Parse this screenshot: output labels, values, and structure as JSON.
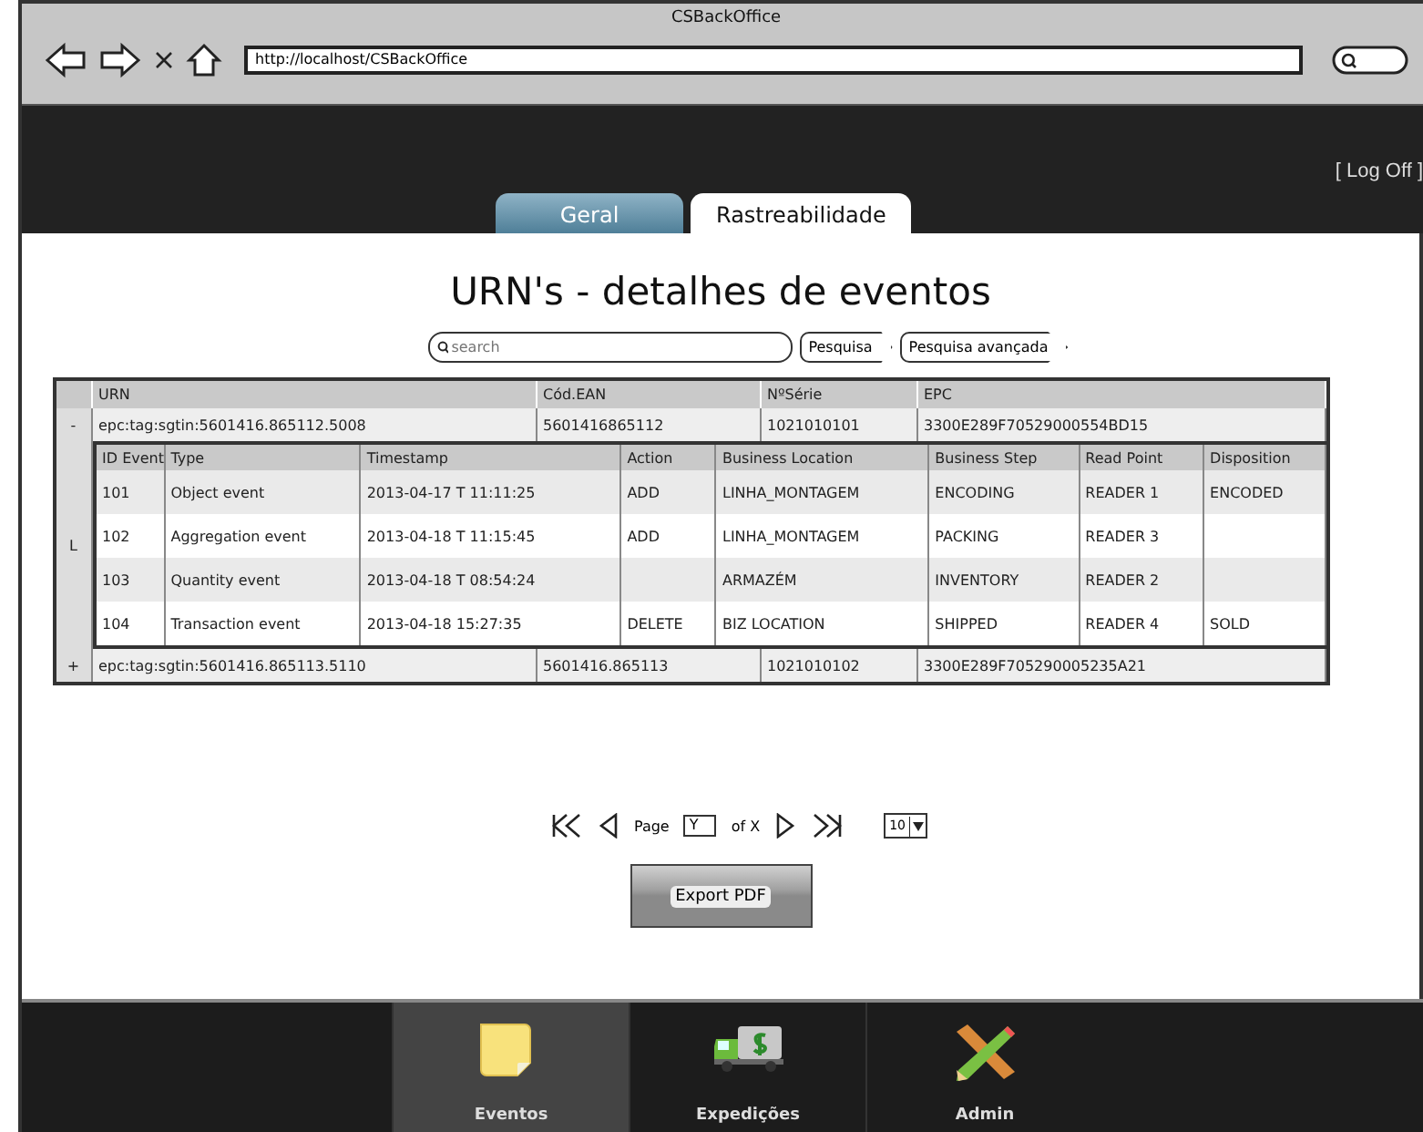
{
  "window": {
    "title": "CSBackOffice"
  },
  "address_bar": {
    "url": "http://localhost/CSBackOffice"
  },
  "header": {
    "logoff": "[ Log Off ]"
  },
  "tabs": [
    {
      "label": "Geral",
      "selected": false
    },
    {
      "label": "Rastreabilidade",
      "selected": true
    }
  ],
  "page_title": "URN's - detalhes de eventos",
  "search": {
    "placeholder": "search"
  },
  "search_buttons": [
    "Pesquisa",
    "Pesquisa avançada"
  ],
  "urn_table": {
    "columns": [
      "URN",
      "Cód.EAN",
      "NºSérie",
      "EPC"
    ],
    "rows": [
      {
        "toggle": "-",
        "cells": [
          "epc:tag:sgtin:5601416.865112.5008",
          "5601416865112",
          "1021010101",
          "3300E289F70529000554BD15"
        ],
        "child_marker": "L",
        "events": {
          "columns": [
            "ID Event",
            "Type",
            "Timestamp",
            "Action",
            "Business Location",
            "Business Step",
            "Read Point",
            "Disposition"
          ],
          "rows": [
            [
              "101",
              "Object event",
              "2013-04-17 T 11:11:25",
              "ADD",
              "LINHA_MONTAGEM",
              "ENCODING",
              "READER 1",
              "ENCODED"
            ],
            [
              "102",
              "Aggregation event",
              "2013-04-18 T 11:15:45",
              "ADD",
              "LINHA_MONTAGEM",
              "PACKING",
              "READER 3",
              ""
            ],
            [
              "103",
              "Quantity event",
              "2013-04-18 T 08:54:24",
              "",
              "ARMAZÉM",
              "INVENTORY",
              "READER 2",
              ""
            ],
            [
              "104",
              "Transaction event",
              "2013-04-18 15:27:35",
              "DELETE",
              "BIZ LOCATION",
              "SHIPPED",
              "READER 4",
              "SOLD"
            ]
          ]
        }
      },
      {
        "toggle": "+",
        "cells": [
          "epc:tag:sgtin:5601416.865113.5110",
          "5601416.865113",
          "1021010102",
          "3300E289F705290005235A21"
        ]
      }
    ]
  },
  "pagination": {
    "page_label": "Page",
    "page_value": "Y",
    "of_label": "of X",
    "per_page": "10"
  },
  "export_button": "Export PDF",
  "bottom_nav": [
    {
      "label": "Eventos",
      "kind": "note",
      "selected": true
    },
    {
      "label": "Expedições",
      "kind": "truck",
      "selected": false
    },
    {
      "label": "Admin",
      "kind": "tools",
      "selected": false
    }
  ]
}
